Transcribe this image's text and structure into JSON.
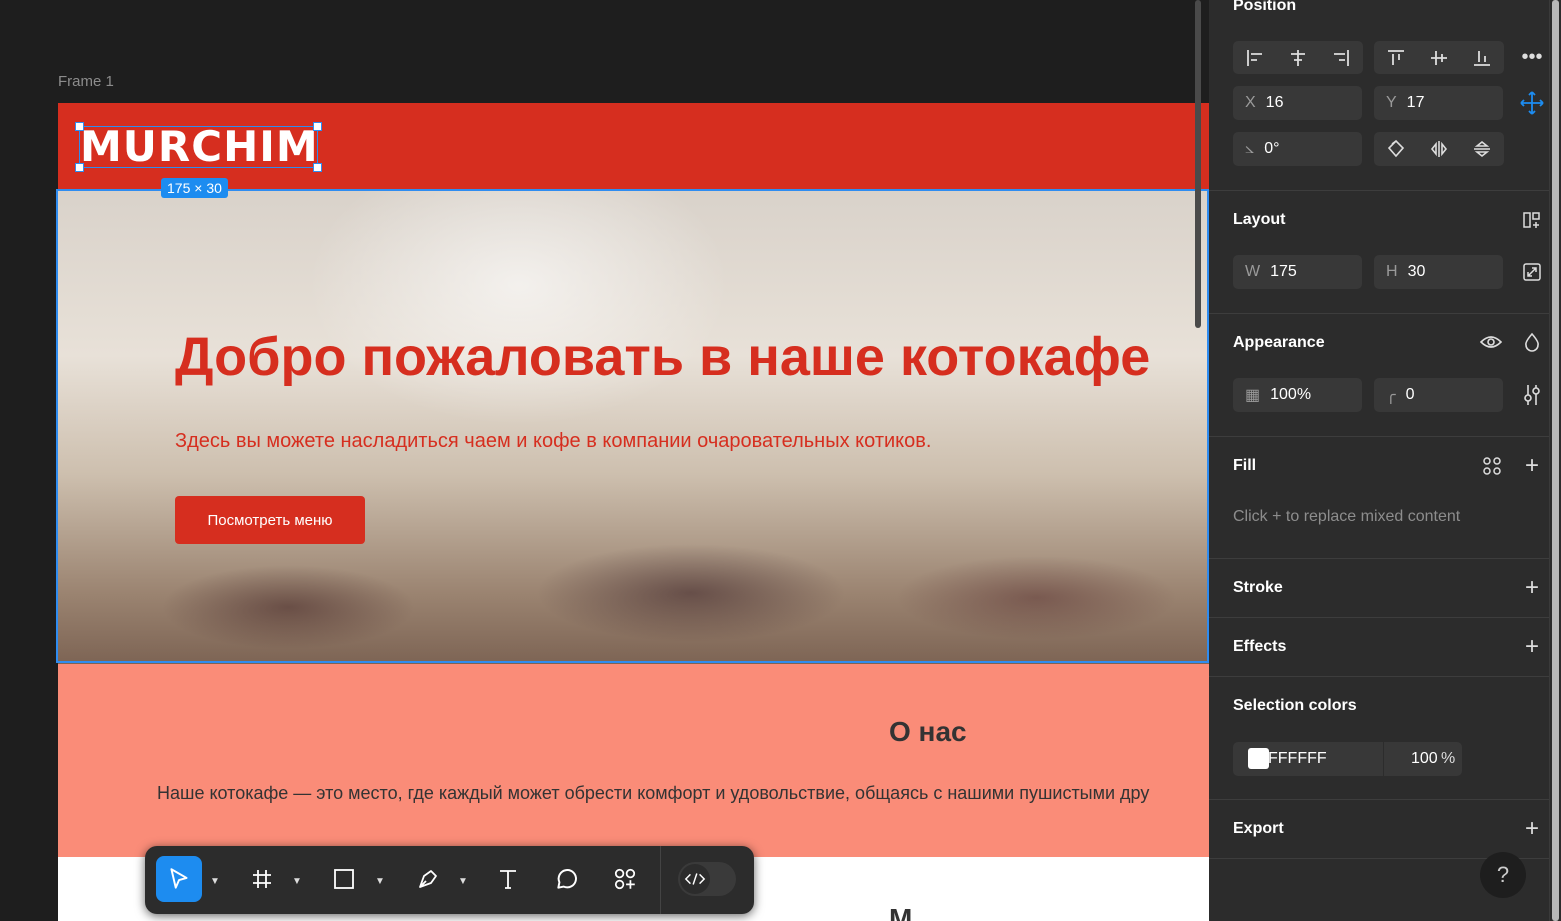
{
  "canvas": {
    "frame_label": "Frame 1",
    "selection_size": "175 × 30"
  },
  "site": {
    "logo": "MURCHIM",
    "hero_title": "Добро пожаловать в наше котокафе",
    "hero_subtitle": "Здесь вы можете насладиться чаем и кофе в компании очаровательных котиков.",
    "hero_button": "Посмотреть меню",
    "about_title": "О нас",
    "about_text": "Наше котокафе — это место, где каждый может обрести комфорт и удовольствие, общаясь с нашими пушистыми дру",
    "next_title": "М",
    "colors": {
      "brand_red": "#d62e1f",
      "about_bg": "#fa8c78"
    }
  },
  "toolbar": {
    "tools": [
      "move-tool",
      "frame-tool",
      "rectangle-tool",
      "pen-tool",
      "text-tool",
      "comment-tool",
      "actions-tool"
    ],
    "active_tool": "move-tool",
    "dev_mode_icon": "code-icon"
  },
  "panel": {
    "position": {
      "title": "Position",
      "x_label": "X",
      "x": "16",
      "y_label": "Y",
      "y": "17",
      "rotation": "0°"
    },
    "layout": {
      "title": "Layout",
      "w_label": "W",
      "w": "175",
      "h_label": "H",
      "h": "30"
    },
    "appearance": {
      "title": "Appearance",
      "opacity": "100%",
      "radius": "0"
    },
    "fill": {
      "title": "Fill",
      "hint": "Click + to replace mixed content"
    },
    "stroke": {
      "title": "Stroke"
    },
    "effects": {
      "title": "Effects"
    },
    "selection_colors": {
      "title": "Selection colors",
      "hex": "FFFFFF",
      "opacity": "100",
      "unit": "%"
    },
    "export": {
      "title": "Export"
    },
    "help": "?"
  }
}
